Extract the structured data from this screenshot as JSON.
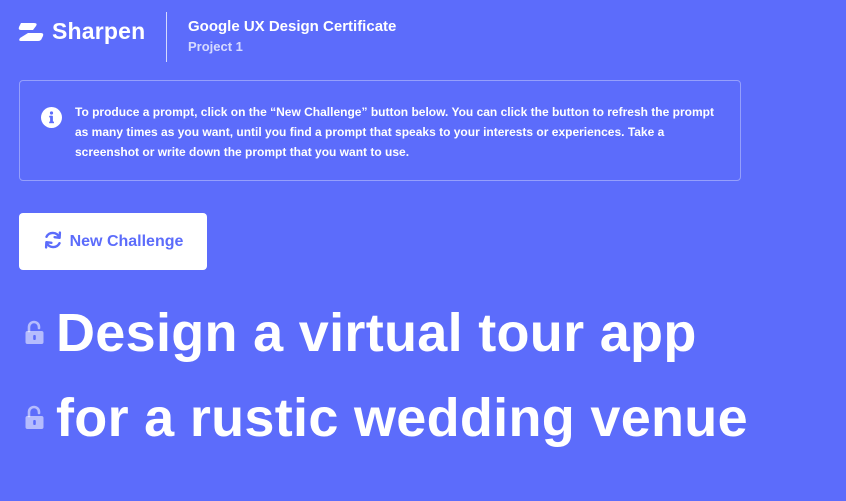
{
  "header": {
    "brand_name": "Sharpen",
    "course_title": "Google UX Design Certificate",
    "course_subtitle": "Project 1"
  },
  "info": {
    "icon": "info-icon",
    "text": "To produce a prompt, click on the “New Challenge” button below. You can click the button to refresh the prompt as many times as you want, until you find a prompt that speaks to your interests or experiences. Take a screenshot or write down the prompt that you want to use."
  },
  "challenge_button": {
    "icon": "refresh-icon",
    "label": "New Challenge"
  },
  "prompt": {
    "lines": [
      {
        "icon": "unlock-icon",
        "text": "Design a virtual tour app"
      },
      {
        "icon": "unlock-icon",
        "text": "for a rustic wedding venue"
      }
    ]
  },
  "colors": {
    "background": "#5c6cfb",
    "text": "#ffffff",
    "button_bg": "#ffffff",
    "button_text": "#5c6cfb"
  }
}
